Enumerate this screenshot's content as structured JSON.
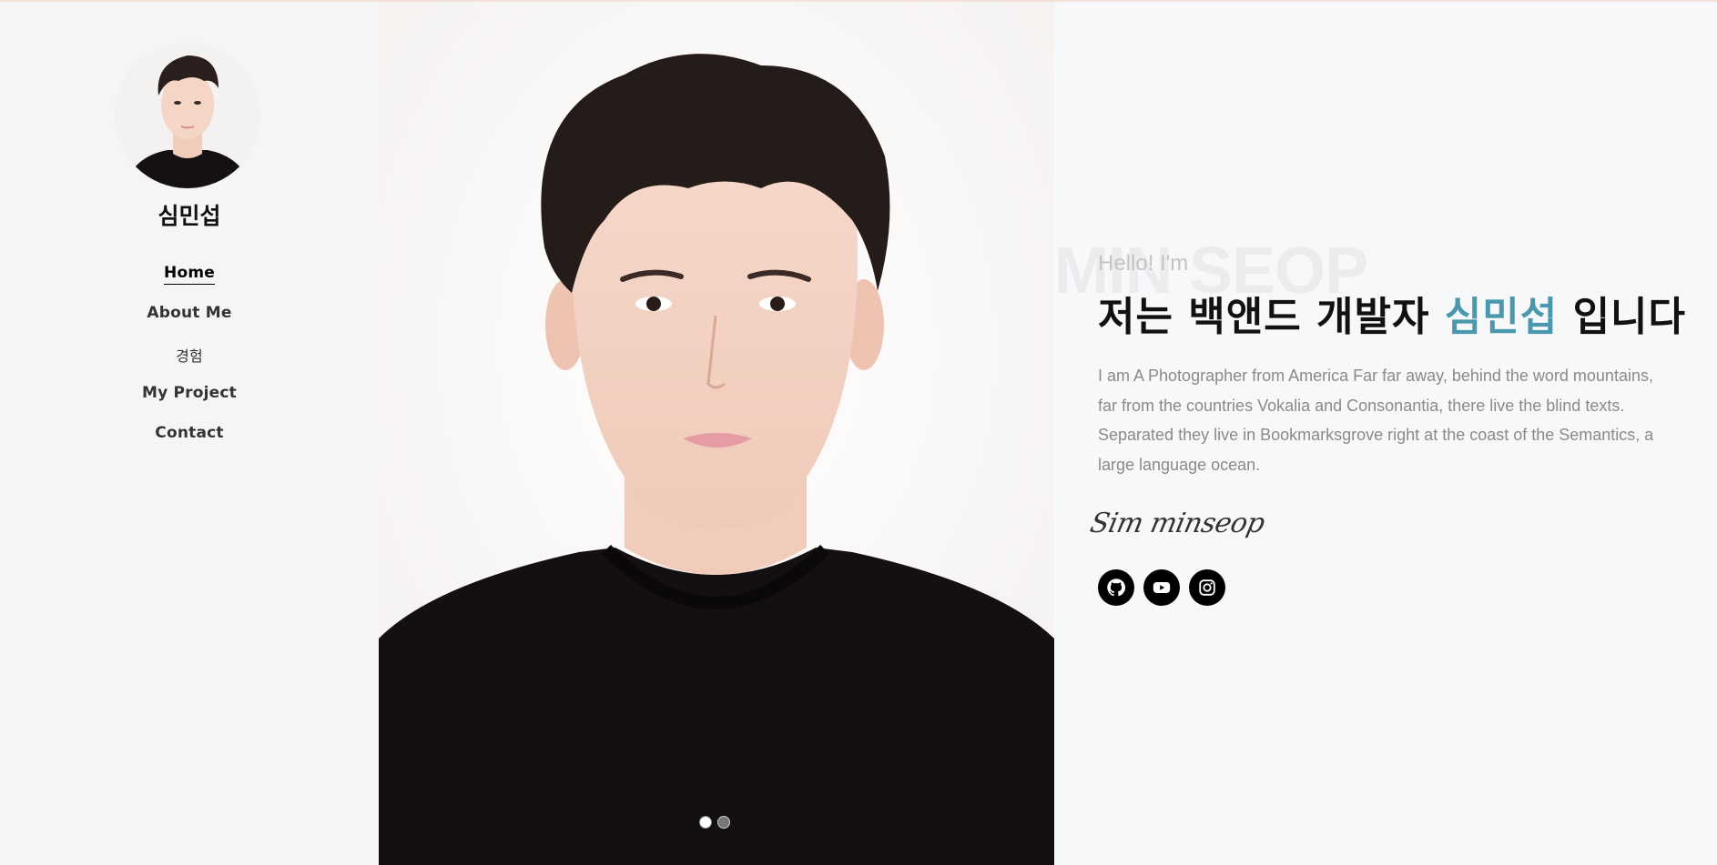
{
  "sidebar": {
    "name": "심민섭",
    "nav": [
      {
        "label": "Home",
        "active": true
      },
      {
        "label": "About Me",
        "active": false
      },
      {
        "label": "경험",
        "active": false
      },
      {
        "label": "My Project",
        "active": false
      },
      {
        "label": "Contact",
        "active": false
      }
    ]
  },
  "hero": {
    "slides_total": 2,
    "active_slide": 1
  },
  "content": {
    "background_word": "MIN SEOP",
    "greeting": "Hello! I'm",
    "headline_prefix": "저는 백앤드 개발자 ",
    "headline_name": "심민섭",
    "headline_suffix": " 입니다",
    "description": "I am A Photographer from America Far far away, behind the word mountains, far from the countries Vokalia and Consonantia, there live the blind texts. Separated they live in Bookmarksgrove right at the coast of the Semantics, a large language ocean.",
    "signature": "Sim minseop",
    "social": [
      {
        "name": "github-icon"
      },
      {
        "name": "youtube-icon"
      },
      {
        "name": "instagram-icon"
      }
    ]
  },
  "colors": {
    "accent": "#4a98ad",
    "sidebar_bg": "#f5f5f5",
    "page_bg": "#f7f8fa"
  }
}
